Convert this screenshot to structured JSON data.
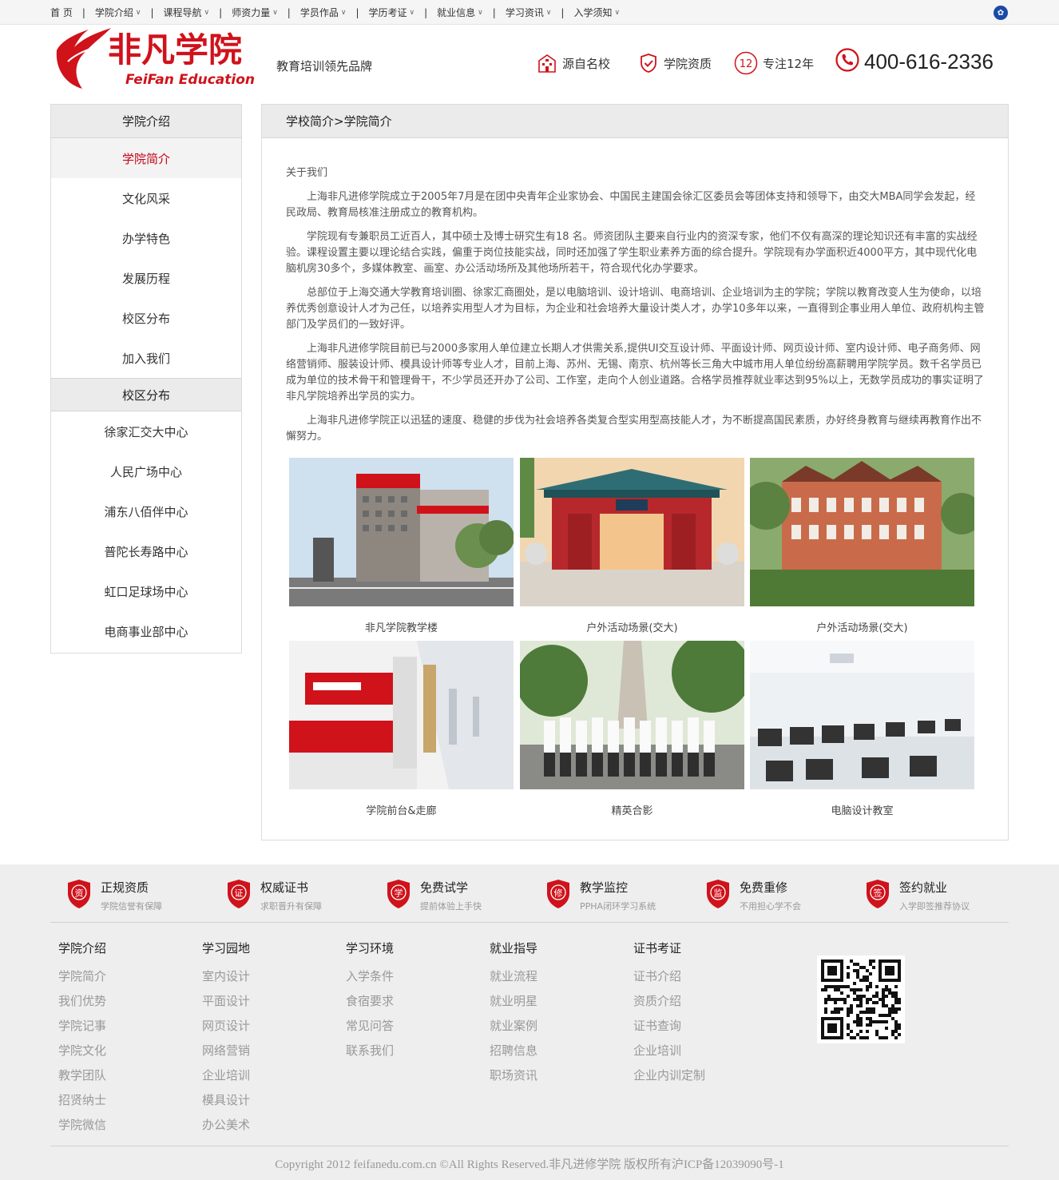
{
  "topnav": {
    "items": [
      {
        "label": "首 页",
        "chevron": false
      },
      {
        "label": "学院介绍",
        "chevron": true
      },
      {
        "label": "课程导航",
        "chevron": true
      },
      {
        "label": "师资力量",
        "chevron": true
      },
      {
        "label": "学员作品",
        "chevron": true
      },
      {
        "label": "学历考证",
        "chevron": true
      },
      {
        "label": "就业信息",
        "chevron": true
      },
      {
        "label": "学习资讯",
        "chevron": true
      },
      {
        "label": "入学须知",
        "chevron": true
      }
    ],
    "separator": "|"
  },
  "header": {
    "logo_cn": "非凡学院",
    "logo_en": "FeiFan Education",
    "slogan": "教育培训领先品牌",
    "features": [
      "源自名校",
      "学院资质",
      "专注12年"
    ],
    "badge_number": "12",
    "phone": "400-616-2336"
  },
  "sidebar": {
    "section1_title": "学院介绍",
    "section1_items": [
      "学院简介",
      "文化风采",
      "办学特色",
      "发展历程",
      "校区分布",
      "加入我们"
    ],
    "section2_title": "校区分布",
    "section2_items": [
      "徐家汇交大中心",
      "人民广场中心",
      "浦东八佰伴中心",
      "普陀长寿路中心",
      "虹口足球场中心",
      "电商事业部中心"
    ]
  },
  "main": {
    "breadcrumb": "学校简介>学院简介",
    "article_title": "关于我们",
    "paragraphs": [
      "上海非凡进修学院成立于2005年7月是在团中央青年企业家协会、中国民主建国会徐汇区委员会等团体支持和领导下，由交大MBA同学会发起，经民政局、教育局核准注册成立的教育机构。",
      "学院现有专兼职员工近百人，其中硕士及博士研究生有18 名。师资团队主要来自行业内的资深专家，他们不仅有高深的理论知识还有丰富的实战经验。课程设置主要以理论结合实践，偏重于岗位技能实战，同时还加强了学生职业素养方面的综合提升。学院现有办学面积近4000平方，其中现代化电脑机房30多个，多媒体教室、画室、办公活动场所及其他场所若干，符合现代化办学要求。",
      "总部位于上海交通大学教育培训圈、徐家汇商圈处，是以电脑培训、设计培训、电商培训、企业培训为主的学院；学院以教育改变人生为使命，以培养优秀创意设计人才为己任，以培养实用型人才为目标，为企业和社会培养大量设计类人才，办学10多年以来，一直得到企事业用人单位、政府机构主管部门及学员们的一致好评。",
      "上海非凡进修学院目前已与2000多家用人单位建立长期人才供需关系,提供UI交互设计师、平面设计师、网页设计师、室内设计师、电子商务师、网络营销师、服装设计师、模具设计师等专业人才，目前上海、苏州、无锡、南京、杭州等长三角大中城市用人单位纷纷高薪聘用学院学员。数千名学员已成为单位的技术骨干和管理骨干，不少学员还开办了公司、工作室，走向个人创业道路。合格学员推荐就业率达到95%以上，无数学员成功的事实证明了非凡学院培养出学员的实力。",
      "上海非凡进修学院正以迅猛的速度、稳健的步伐为社会培养各类复合型实用型高技能人才，为不断提高国民素质，办好终身教育与继续再教育作出不懈努力。"
    ],
    "gallery": [
      {
        "caption": "非凡学院教学楼",
        "scene": "building"
      },
      {
        "caption": "户外活动场景(交大)",
        "scene": "gate"
      },
      {
        "caption": "户外活动场景(交大)",
        "scene": "hall"
      },
      {
        "caption": "学院前台&走廊",
        "scene": "lobby"
      },
      {
        "caption": "精英合影",
        "scene": "group"
      },
      {
        "caption": "电脑设计教室",
        "scene": "classroom"
      }
    ]
  },
  "footer": {
    "badges": [
      {
        "char": "资",
        "title": "正规资质",
        "sub": "学院信誉有保障"
      },
      {
        "char": "证",
        "title": "权威证书",
        "sub": "求职晋升有保障"
      },
      {
        "char": "学",
        "title": "免费试学",
        "sub": "提前体验上手快"
      },
      {
        "char": "修",
        "title": "教学监控",
        "sub": "PPHA闭环学习系统"
      },
      {
        "char": "监",
        "title": "免费重修",
        "sub": "不用担心学不会"
      },
      {
        "char": "签",
        "title": "签约就业",
        "sub": "入学即签推荐协议"
      }
    ],
    "columns": [
      {
        "title": "学院介绍",
        "links": [
          "学院简介",
          "我们优势",
          "学院记事",
          "学院文化",
          "教学团队",
          "招贤纳士",
          "学院微信"
        ]
      },
      {
        "title": "学习园地",
        "links": [
          "室内设计",
          "平面设计",
          "网页设计",
          "网络营销",
          "企业培训",
          "模具设计",
          "办公美术"
        ]
      },
      {
        "title": "学习环境",
        "links": [
          "入学条件",
          "食宿要求",
          "常见问答",
          "联系我们"
        ]
      },
      {
        "title": "就业指导",
        "links": [
          "就业流程",
          "就业明星",
          "就业案例",
          "招聘信息",
          "职场资讯"
        ]
      },
      {
        "title": "证书考证",
        "links": [
          "证书介绍",
          "资质介绍",
          "证书查询",
          "企业培训",
          "企业内训定制"
        ]
      }
    ],
    "copyright": "Copyright 2012 feifanedu.com.cn ©All Rights Reserved.非凡进修学院 版权所有沪ICP备12039090号-1"
  },
  "colors": {
    "brand_red": "#d0121b",
    "active_red": "#c40015",
    "panel_gray": "#ebebeb"
  }
}
